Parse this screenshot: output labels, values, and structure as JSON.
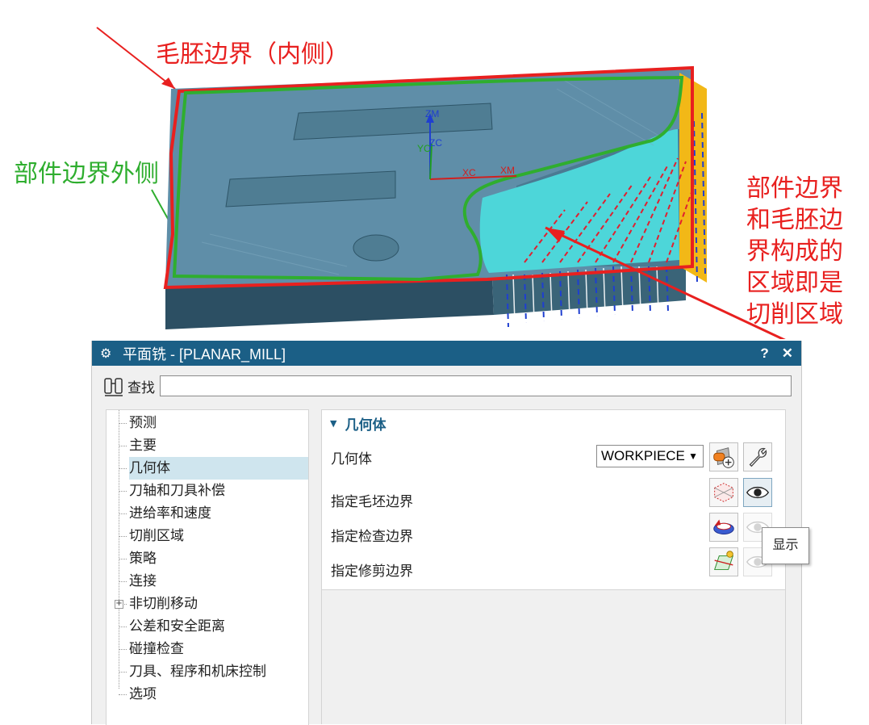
{
  "viewport": {
    "annotations": {
      "blank_boundary": "毛胚边界（内侧）",
      "part_boundary": "部件边界外侧",
      "cut_region_lines": [
        "部件边界",
        "和毛胚边",
        "界构成的",
        "区域即是",
        "切削区域"
      ]
    },
    "axes": {
      "zm": "ZM",
      "zc": "ZC",
      "yc": "YC",
      "xc": "XC",
      "xm": "XM"
    },
    "colors": {
      "blank_boundary": "#e8201f",
      "part_boundary": "#2fae2f",
      "part_body": "#5f8ea8",
      "floor": "#4dd6d9"
    }
  },
  "dialog": {
    "title": "平面铣 - [PLANAR_MILL]",
    "help_button": "?",
    "close_button": "✕",
    "find_label": "查找",
    "find_value": "",
    "nav_items": [
      {
        "label": "预测"
      },
      {
        "label": "主要"
      },
      {
        "label": "几何体",
        "selected": true
      },
      {
        "label": "刀轴和刀具补偿"
      },
      {
        "label": "进给率和速度"
      },
      {
        "label": "切削区域"
      },
      {
        "label": "策略"
      },
      {
        "label": "连接"
      },
      {
        "label": "非切削移动",
        "expandable": true
      },
      {
        "label": "公差和安全距离"
      },
      {
        "label": "碰撞检查"
      },
      {
        "label": "刀具、程序和机床控制"
      },
      {
        "label": "选项"
      }
    ],
    "section": {
      "title": "几何体",
      "geometry_label": "几何体",
      "geometry_value": "WORKPIECE",
      "blank_boundary_label": "指定毛坯边界",
      "check_boundary_label": "指定检查边界",
      "trim_boundary_label": "指定修剪边界"
    },
    "tooltip": "显示",
    "accent": "#1b5f86"
  }
}
